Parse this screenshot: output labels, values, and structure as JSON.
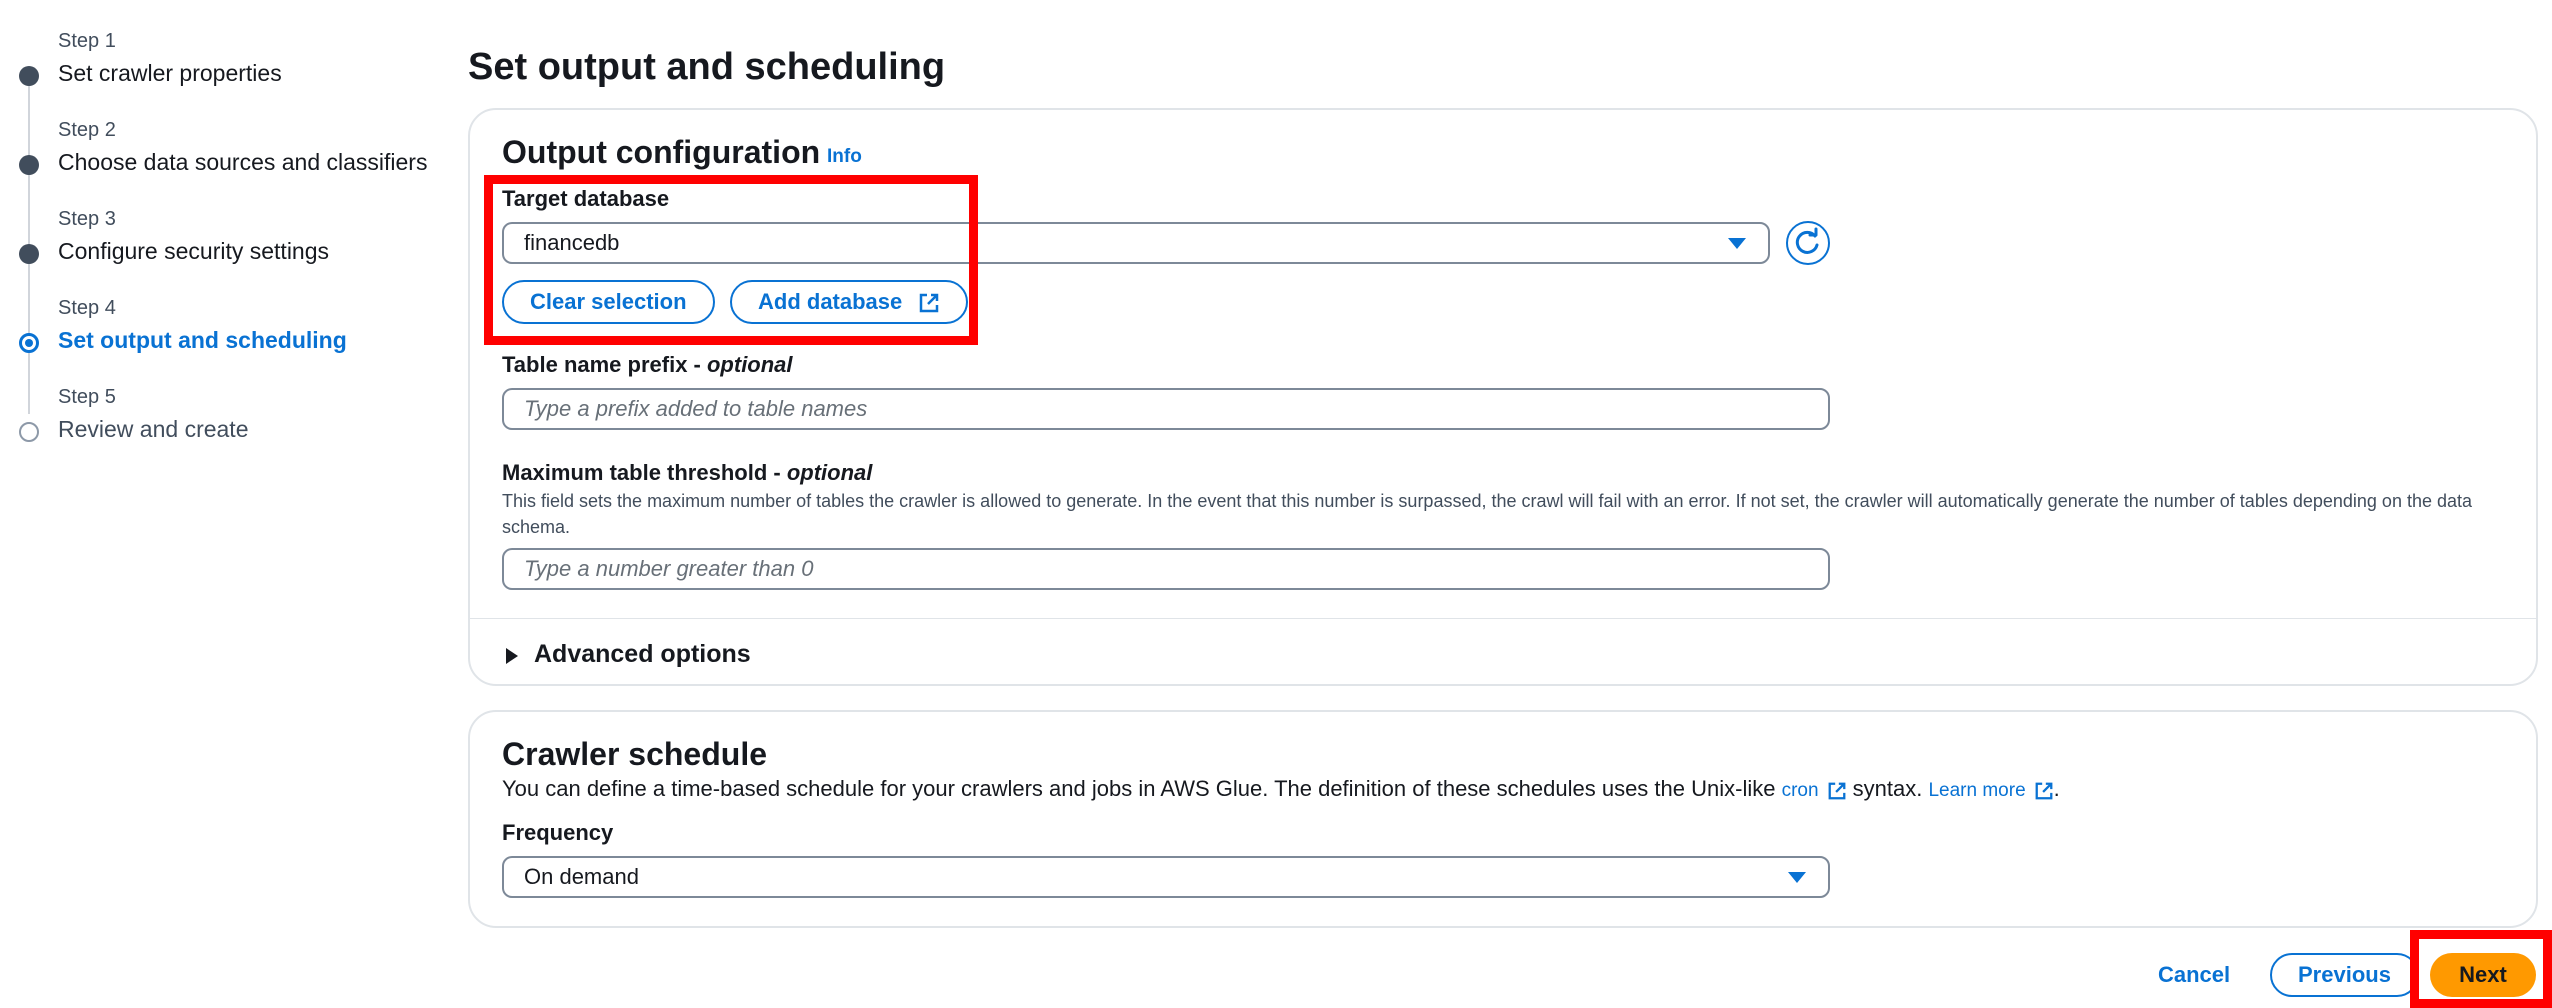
{
  "steps": [
    {
      "num": "Step 1",
      "title": "Set crawler properties",
      "state": "done"
    },
    {
      "num": "Step 2",
      "title": "Choose data sources and classifiers",
      "state": "done"
    },
    {
      "num": "Step 3",
      "title": "Configure security settings",
      "state": "done"
    },
    {
      "num": "Step 4",
      "title": "Set output and scheduling",
      "state": "active"
    },
    {
      "num": "Step 5",
      "title": "Review and create",
      "state": "pending"
    }
  ],
  "page_title": "Set output and scheduling",
  "output": {
    "title": "Output configuration",
    "info": "Info",
    "target_db_label": "Target database",
    "target_db_value": "financedb",
    "clear_selection": "Clear selection",
    "add_database": "Add database",
    "prefix_label": "Table name prefix - ",
    "prefix_optional": "optional",
    "prefix_placeholder": "Type a prefix added to table names",
    "threshold_label": "Maximum table threshold - ",
    "threshold_optional": "optional",
    "threshold_desc": "This field sets the maximum number of tables the crawler is allowed to generate. In the event that this number is surpassed, the crawl will fail with an error. If not set, the crawler will automatically generate the number of tables depending on the data schema.",
    "threshold_placeholder": "Type a number greater than 0",
    "advanced": "Advanced options"
  },
  "schedule": {
    "title": "Crawler schedule",
    "desc_1": "You can define a time-based schedule for your crawlers and jobs in AWS Glue. The definition of these schedules uses the Unix-like ",
    "cron": "cron",
    "desc_2": " syntax. ",
    "learn_more": "Learn more",
    "desc_3": ".",
    "frequency_label": "Frequency",
    "frequency_value": "On demand"
  },
  "footer": {
    "cancel": "Cancel",
    "previous": "Previous",
    "next": "Next"
  },
  "colors": {
    "accent": "#0972d3",
    "primary_button": "#ff9900",
    "highlight": "#ff0000"
  }
}
